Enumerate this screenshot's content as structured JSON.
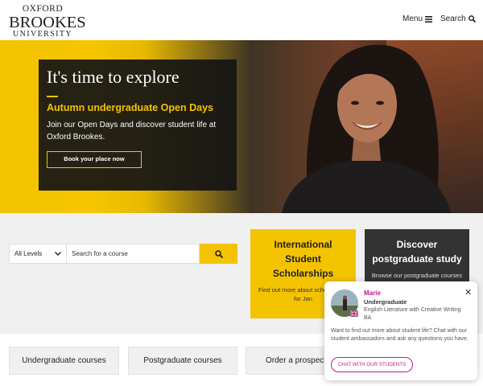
{
  "header": {
    "logo": {
      "line1": "OXFORD",
      "line2": "BROOKES",
      "line3": "UNIVERSITY"
    },
    "menu_label": "Menu",
    "search_label": "Search"
  },
  "hero": {
    "title": "It's time to explore",
    "subtitle": "Autumn undergraduate Open Days",
    "text": "Join our Open Days and discover student life at Oxford Brookes.",
    "button_label": "Book your place now"
  },
  "course_search": {
    "level_selected": "All Levels",
    "placeholder": "Search for a course"
  },
  "cards": {
    "scholarships": {
      "title": "International Student Scholarships",
      "text": "Find out more about scholarships for Jan"
    },
    "postgraduate": {
      "title": "Discover postgraduate study",
      "text": "Browse our postgraduate courses"
    }
  },
  "bottom_links": {
    "undergraduate": "Undergraduate courses",
    "postgraduate": "Postgraduate courses",
    "prospectus": "Order a prospec"
  },
  "chat": {
    "name": "Marie",
    "role": "Undergraduate",
    "course": "English Literature with Creative Writing BA",
    "message": "Want to find out more about student life? Chat with our student ambassadors and ask any questions you have.",
    "button_label": "CHAT WITH OUR STUDENTS"
  },
  "colors": {
    "brand_yellow": "#f4c300",
    "dark": "#333333",
    "chat_accent": "#c2168c"
  },
  "icons": [
    "menu-icon",
    "search-icon",
    "chevron-down-icon",
    "close-icon",
    "uk-flag-icon"
  ]
}
